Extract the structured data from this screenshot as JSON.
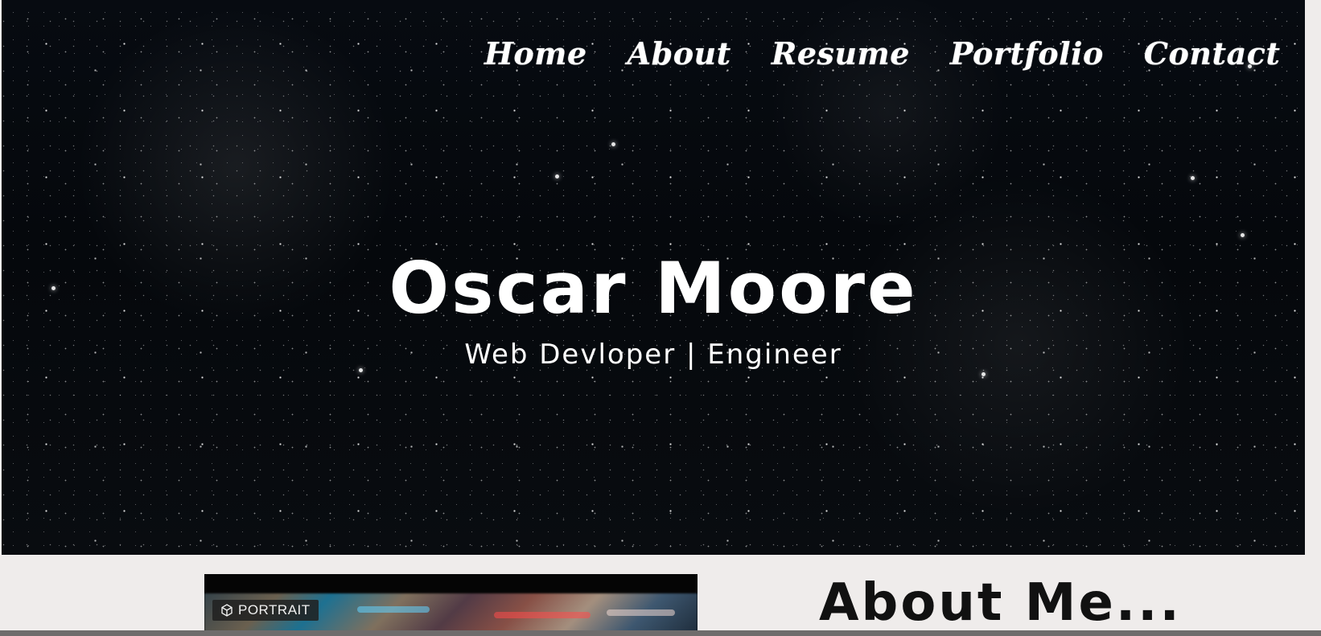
{
  "nav": {
    "items": [
      {
        "label": "Home"
      },
      {
        "label": "About"
      },
      {
        "label": "Resume"
      },
      {
        "label": "Portfolio"
      },
      {
        "label": "Contact"
      }
    ]
  },
  "hero": {
    "title": "Oscar Moore",
    "subtitle": "Web Devloper | Engineer"
  },
  "about": {
    "heading": "About Me...",
    "image_badge": "PORTRAIT"
  },
  "icons": {
    "portrait_badge_icon": "cube-icon"
  },
  "colors": {
    "hero_background": "#05080c",
    "page_background": "#efeceb",
    "text_light": "#ffffff",
    "text_dark": "#111111"
  }
}
